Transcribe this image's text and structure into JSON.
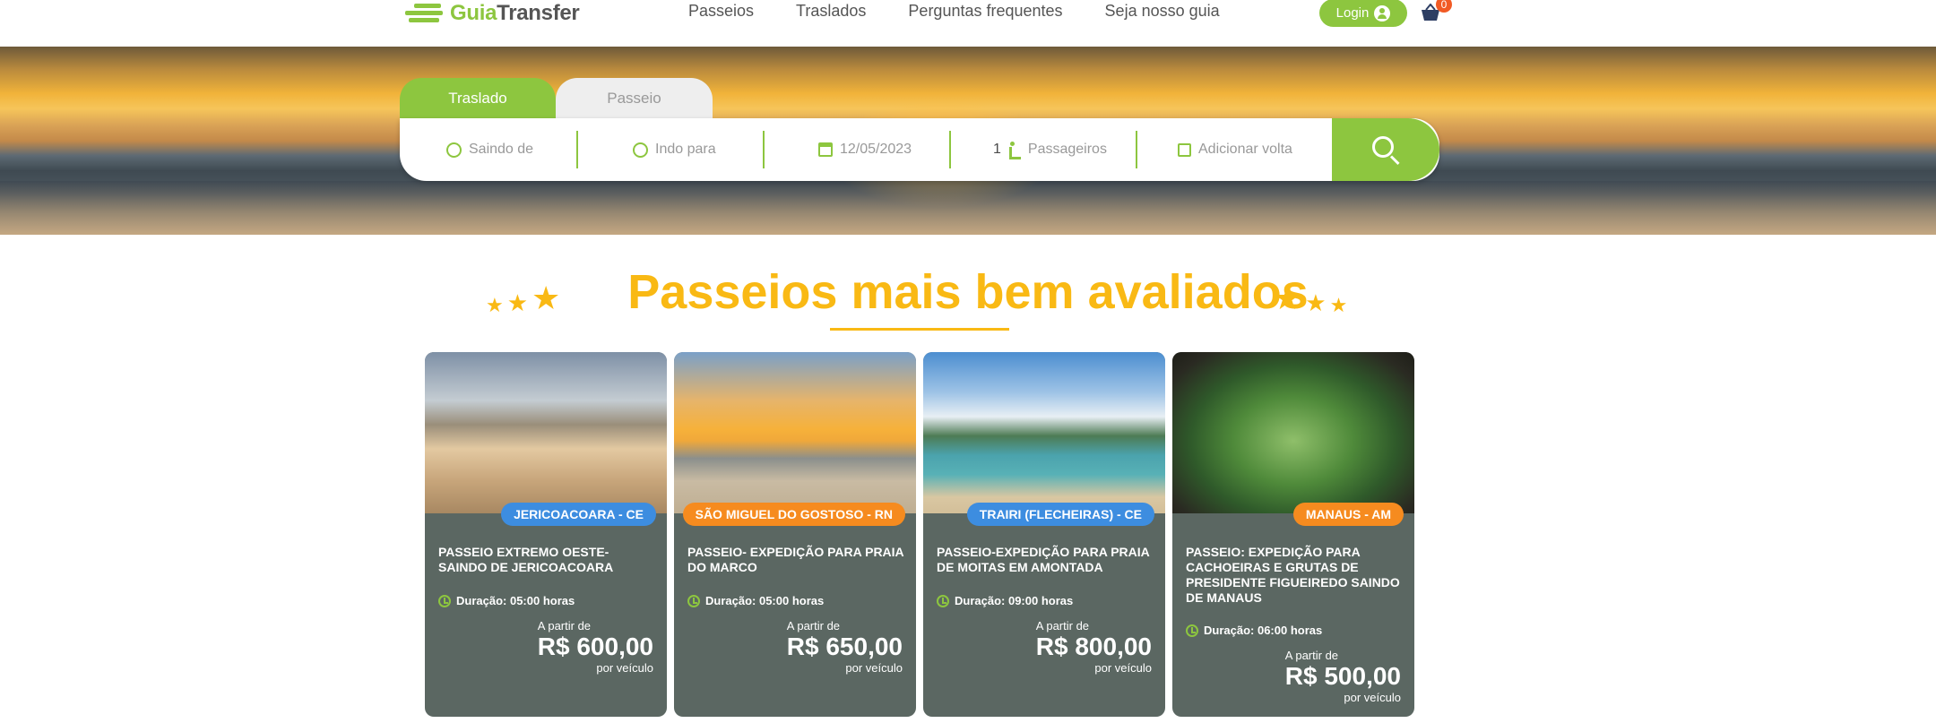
{
  "header": {
    "logo_prefix": "Guia",
    "logo_suffix": "Transfer",
    "nav": [
      "Passeios",
      "Traslados",
      "Perguntas frequentes",
      "Seja nosso guia"
    ],
    "login_label": "Login",
    "cart_count": "0"
  },
  "search": {
    "tabs": [
      "Traslado",
      "Passeio"
    ],
    "from_placeholder": "Saindo de",
    "to_placeholder": "Indo para",
    "date": "12/05/2023",
    "passengers_count": "1",
    "passengers_label": "Passageiros",
    "return_label": "Adicionar volta"
  },
  "section": {
    "title": "Passeios mais bem avaliados"
  },
  "colors": {
    "brand_green": "#8dc63f",
    "title_yellow": "#f9b914",
    "card_bg": "#5b6762",
    "badge_blue": "#3d8de0",
    "badge_orange": "#f68b1f"
  },
  "cards": [
    {
      "location": "JERICOACOARA - CE",
      "badge_color": "blue",
      "title": "PASSEIO EXTREMO OESTE- SAINDO DE JERICOACOARA",
      "duration": "Duração: 05:00 horas",
      "price_from": "A partir de",
      "price": "R$ 600,00",
      "price_per": "por veículo"
    },
    {
      "location": "SÃO MIGUEL DO GOSTOSO - RN",
      "badge_color": "orange",
      "title": "PASSEIO- EXPEDIÇÃO PARA PRAIA DO MARCO",
      "duration": "Duração: 05:00 horas",
      "price_from": "A partir de",
      "price": "R$ 650,00",
      "price_per": "por veículo"
    },
    {
      "location": "TRAIRI (FLECHEIRAS) - CE",
      "badge_color": "blue",
      "title": "PASSEIO-EXPEDIÇÃO PARA PRAIA DE MOITAS EM AMONTADA",
      "duration": "Duração: 09:00 horas",
      "price_from": "A partir de",
      "price": "R$ 800,00",
      "price_per": "por veículo"
    },
    {
      "location": "MANAUS - AM",
      "badge_color": "orange",
      "title": "PASSEIO: EXPEDIÇÃO PARA CACHOEIRAS E GRUTAS DE PRESIDENTE FIGUEIREDO SAINDO DE MANAUS",
      "duration": "Duração: 06:00 horas",
      "price_from": "A partir de",
      "price": "R$ 500,00",
      "price_per": "por veículo"
    }
  ]
}
